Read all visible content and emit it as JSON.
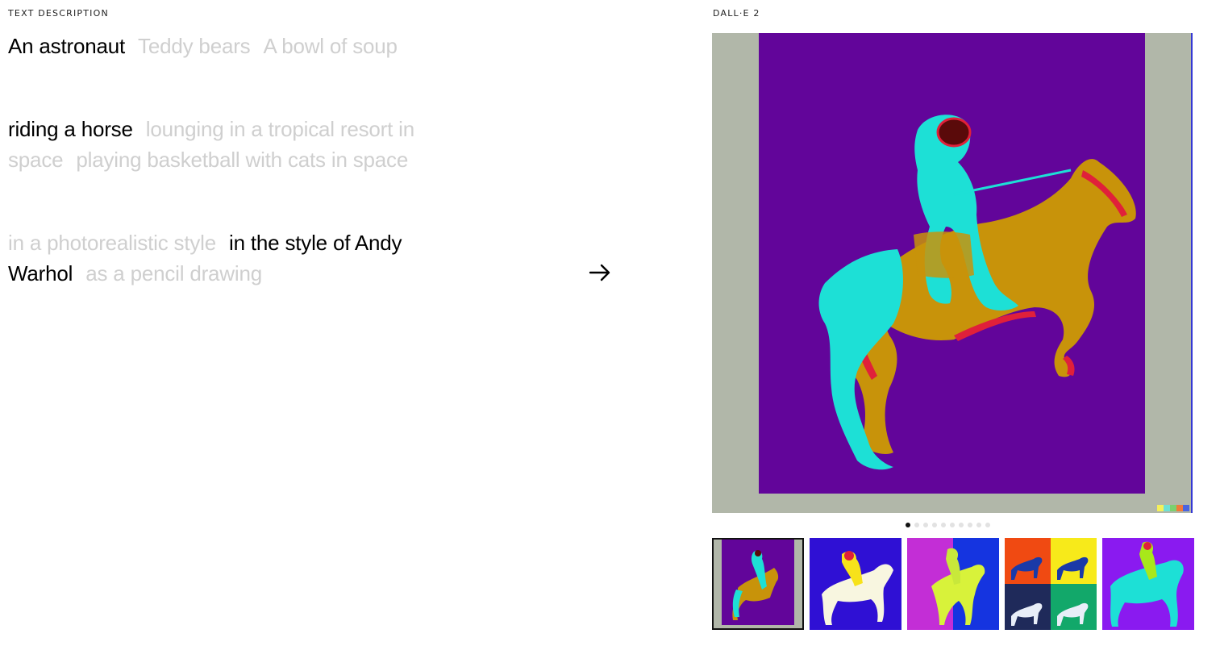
{
  "labels": {
    "left": "TEXT DESCRIPTION",
    "right": "DALL·E 2"
  },
  "subject_options": [
    {
      "label": "An astronaut",
      "selected": true
    },
    {
      "label": "Teddy bears",
      "selected": false
    },
    {
      "label": "A bowl of soup",
      "selected": false
    }
  ],
  "action_options": [
    {
      "label": "riding a horse",
      "selected": true
    },
    {
      "label": "lounging in a tropical resort in space",
      "selected": false
    },
    {
      "label": "playing basketball with cats in space",
      "selected": false
    }
  ],
  "style_options": [
    {
      "label": "in a photorealistic style",
      "selected": false
    },
    {
      "label": "in the style of Andy Warhol",
      "selected": true
    },
    {
      "label": "as a pencil drawing",
      "selected": false
    }
  ],
  "arrow_icon": "arrow-right-icon",
  "carousel": {
    "total": 10,
    "active_index": 0
  },
  "colors": {
    "selected_text": "#000000",
    "unselected_text": "#cfcfcf",
    "panel_purple": "#62059a",
    "panel_gray": "#b1b7a9",
    "figure_cyan": "#1de0d6",
    "horse_ochre": "#c8930a",
    "accent_red": "#e0203a"
  }
}
